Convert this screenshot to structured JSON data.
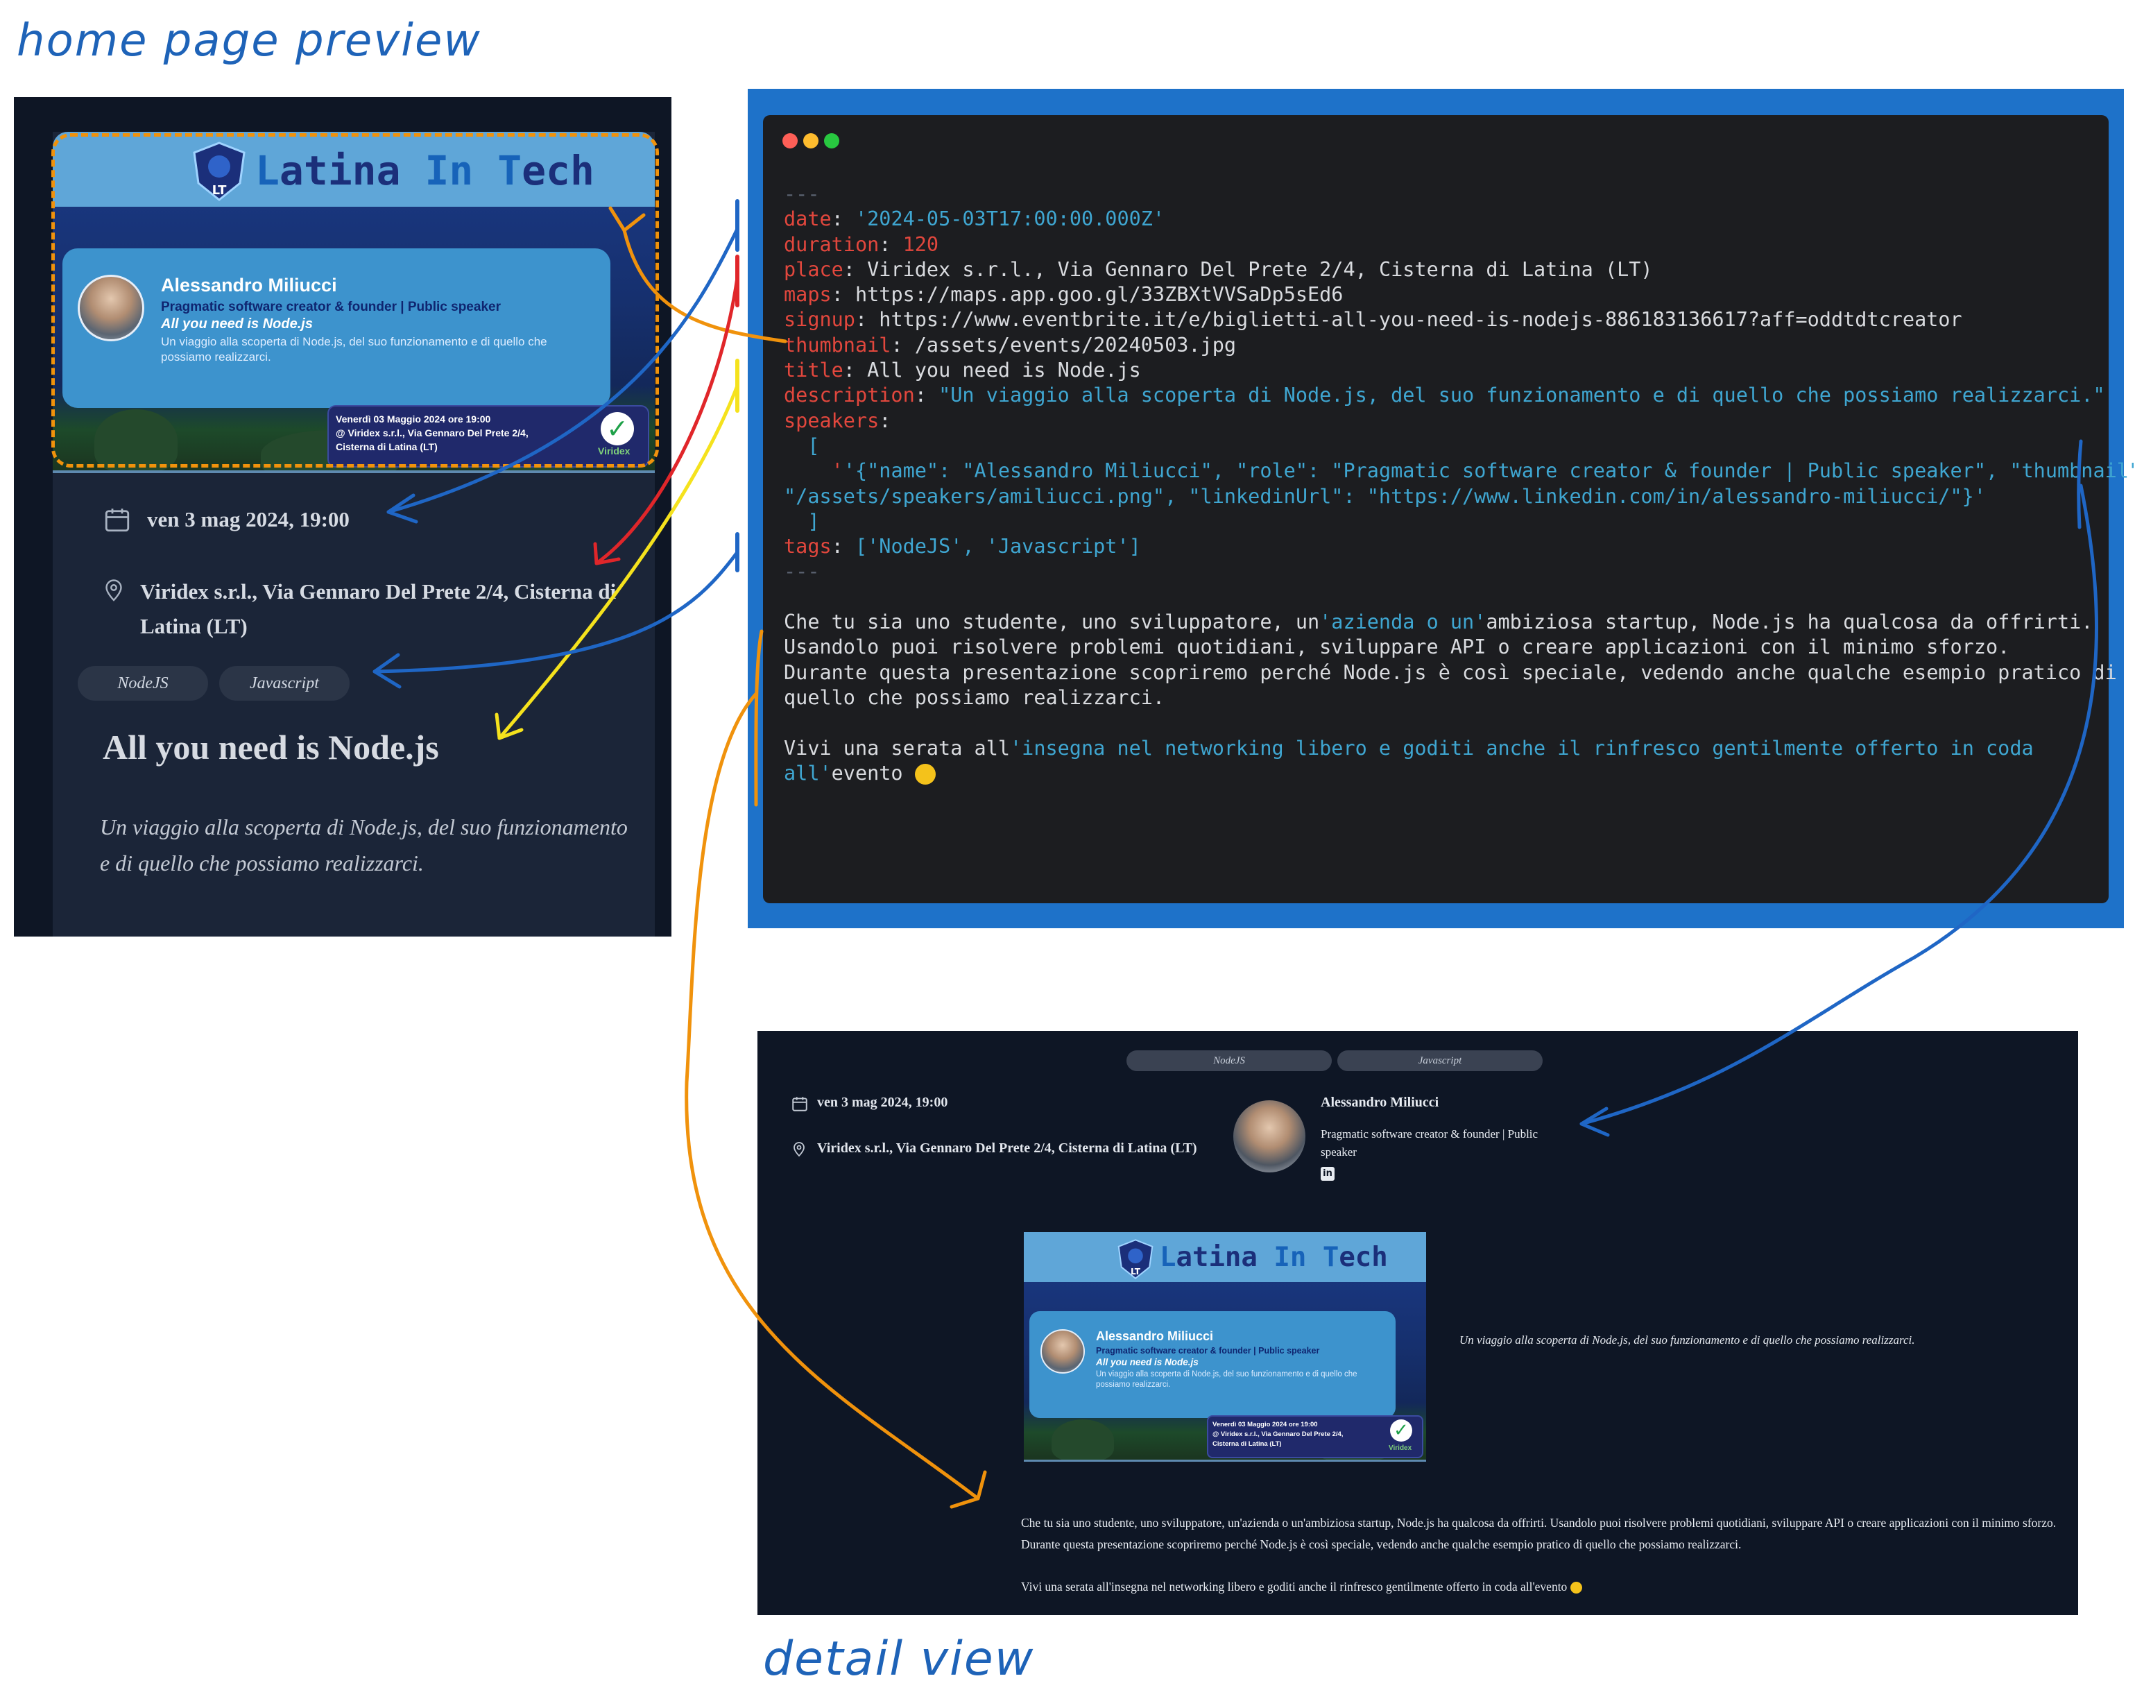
{
  "labels": {
    "home_preview": "home page preview",
    "detail_view": "detail view"
  },
  "banner": {
    "logo_text": "Latina In Tech",
    "logo_l": "L",
    "logo_mid": "atina ",
    "logo_i": "In",
    "logo_t": " T",
    "logo_end": "ech",
    "speaker_name": "Alessandro Miliucci",
    "speaker_role": "Pragmatic software creator & founder | Public speaker",
    "event_title": "All you need is Node.js",
    "event_desc": "Un viaggio alla scoperta di Node.js, del suo funzionamento e di quello che possiamo realizzarci.",
    "date_line1": "Venerdì 03 Maggio 2024 ore 19:00",
    "date_line2": "@ Viridex s.r.l., Via Gennaro Del Prete 2/4,",
    "date_line3": "Cisterna di Latina (LT)",
    "sponsor": "Viridex"
  },
  "home": {
    "date": "ven 3 mag 2024, 19:00",
    "place": "Viridex s.r.l., Via Gennaro Del Prete 2/4, Cisterna di Latina (LT)",
    "tags": [
      "NodeJS",
      "Javascript"
    ],
    "title": "All you need is Node.js",
    "description": "Un viaggio alla scoperta di Node.js, del suo funzionamento e di quello che possiamo realizzarci."
  },
  "code": {
    "sep": "---",
    "date_key": "date",
    "date_val": "'2024-05-03T17:00:00.000Z'",
    "duration_key": "duration",
    "duration_val": "120",
    "place_key": "place",
    "place_val": "Viridex s.r.l., Via Gennaro Del Prete 2/4, Cisterna di Latina (LT)",
    "maps_key": "maps",
    "maps_val": "https://maps.app.goo.gl/33ZBXtVVSaDp5sEd6",
    "signup_key": "signup",
    "signup_val": "https://www.eventbrite.it/e/biglietti-all-you-need-is-nodejs-886183136617?aff=oddtdtcreator",
    "thumbnail_key": "thumbnail",
    "thumbnail_val": "/assets/events/20240503.jpg",
    "title_key": "title",
    "title_val": "All you need is Node.js",
    "description_key": "description",
    "description_val": "\"Un viaggio alla scoperta di Node.js, del suo funzionamento e di quello che possiamo realizzarci.\"",
    "speakers_key": "speakers",
    "bracket_open": "[",
    "speaker_line1": "'{\"name\": \"Alessandro Miliucci\", \"role\": \"Pragmatic software creator & founder | Public speaker\", \"thumbnail\":",
    "speaker_line2": "\"/assets/speakers/amiliucci.png\", \"linkedinUrl\": \"https://www.linkedin.com/in/alessandro-miliucci/\"}'",
    "bracket_close": "]",
    "tags_key": "tags",
    "tags_val": "['NodeJS', 'Javascript']",
    "body1a": "Che tu sia uno studente, uno sviluppatore, un",
    "body1b": "'azienda o un'",
    "body1c": "ambiziosa startup, Node.js ha qualcosa da offrirti.",
    "body2": "Usandolo puoi risolvere problemi quotidiani, sviluppare API o creare applicazioni con il minimo sforzo.",
    "body3": "Durante questa presentazione scopriremo perché Node.js è così speciale, vedendo anche qualche esempio pratico di",
    "body4": "quello che possiamo realizzarci.",
    "body5a": "Vivi una serata all",
    "body5b": "'insegna nel networking libero e goditi anche il rinfresco gentilmente offerto in coda",
    "body6a": "all'",
    "body6b": "evento"
  },
  "detail": {
    "tags": [
      "NodeJS",
      "Javascript"
    ],
    "date": "ven 3 mag 2024, 19:00",
    "place": "Viridex s.r.l., Via Gennaro Del Prete 2/4, Cisterna di Latina (LT)",
    "speaker_name": "Alessandro Miliucci",
    "speaker_role": "Pragmatic software creator & founder | Public speaker",
    "description": "Un viaggio alla scoperta di Node.js, del suo funzionamento e di quello che possiamo realizzarci.",
    "body1": "Che tu sia uno studente, uno sviluppatore, un'azienda o un'ambiziosa startup, Node.js ha qualcosa da offrirti. Usandolo puoi risolvere problemi quotidiani, sviluppare API o creare applicazioni con il minimo sforzo. Durante questa presentazione scopriremo perché Node.js è così speciale, vedendo anche qualche esempio pratico di quello che possiamo realizzarci.",
    "body2": "Vivi una serata all'insegna nel networking libero e goditi anche il rinfresco gentilmente offerto in coda all'evento"
  },
  "colors": {
    "arrow_orange": "#f0920c",
    "arrow_blue": "#1f66c5",
    "arrow_red": "#e0262a",
    "arrow_yellow": "#f5e21d",
    "code_key": "#e2473d",
    "code_string": "#3fa6d1"
  },
  "icons": {
    "calendar": "calendar-icon",
    "location": "map-pin-icon",
    "linkedin": "linkedin-icon",
    "emoji": "smile-emoji-icon"
  }
}
